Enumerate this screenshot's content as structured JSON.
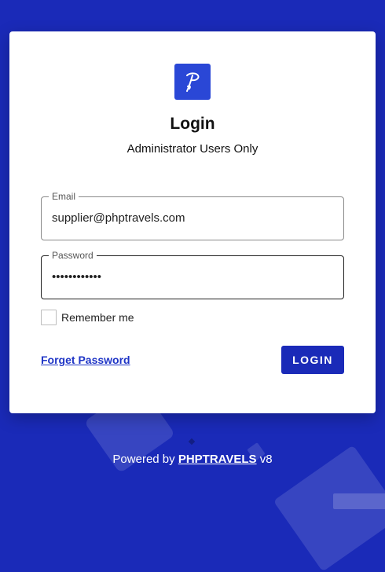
{
  "login": {
    "title": "Login",
    "subtitle": "Administrator Users Only",
    "email": {
      "label": "Email",
      "value": "supplier@phptravels.com"
    },
    "password": {
      "label": "Password",
      "value": "••••••••••••"
    },
    "remember_label": "Remember me",
    "forget_label": "Forget Password",
    "login_label": "LOGIN"
  },
  "footer": {
    "prefix": "Powered by ",
    "brand": "PHPTRAVELS",
    "version": " v8"
  },
  "colors": {
    "background": "#1a2ab8",
    "logo": "#2a47d6",
    "link": "#1f35c6",
    "button": "#1a2ab8"
  },
  "icons": {
    "logo": "phptravels-logo-icon"
  }
}
